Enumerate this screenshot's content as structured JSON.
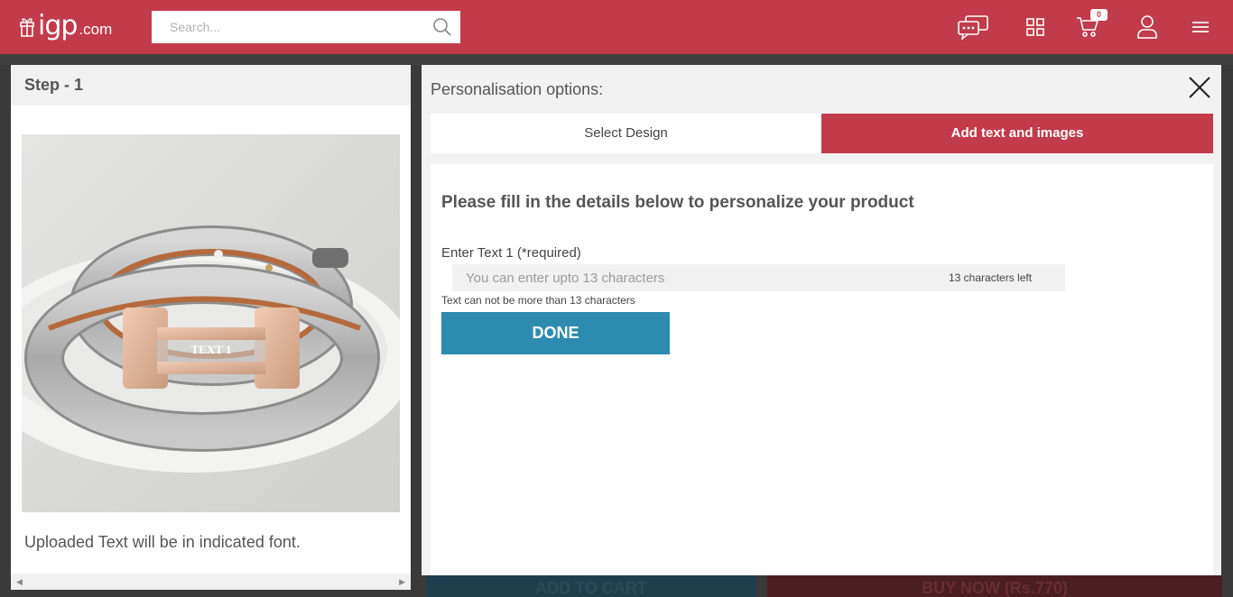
{
  "header": {
    "logo_text": "igp",
    "logo_suffix": ".com",
    "search_placeholder": "Search...",
    "cart_count": "0",
    "icons": [
      "chat-icon",
      "grid-icon",
      "cart-icon",
      "user-icon",
      "menu-icon"
    ],
    "brand_color": "#c13b4a"
  },
  "background": {
    "add_to_cart_label": "ADD TO CART",
    "buy_now_label": "BUY NOW (Rs.770)"
  },
  "left_panel": {
    "step_title": "Step - 1",
    "product_overlay_text": "TEXT 1",
    "note": "Uploaded Text will be in indicated font."
  },
  "right_panel": {
    "title": "Personalisation options:",
    "tabs": [
      {
        "label": "Select Design",
        "active": false
      },
      {
        "label": "Add text and images",
        "active": true
      }
    ],
    "form": {
      "heading": "Please fill in the details below to personalize your product",
      "field_label": "Enter Text 1 (*required)",
      "input_placeholder": "You can enter upto 13 characters",
      "input_value": "",
      "chars_left": "13 characters left",
      "hint": "Text can not be more than 13 characters",
      "done_label": "DONE"
    }
  },
  "colors": {
    "accent": "#c13b4a",
    "done_button": "#2e8bb0"
  }
}
